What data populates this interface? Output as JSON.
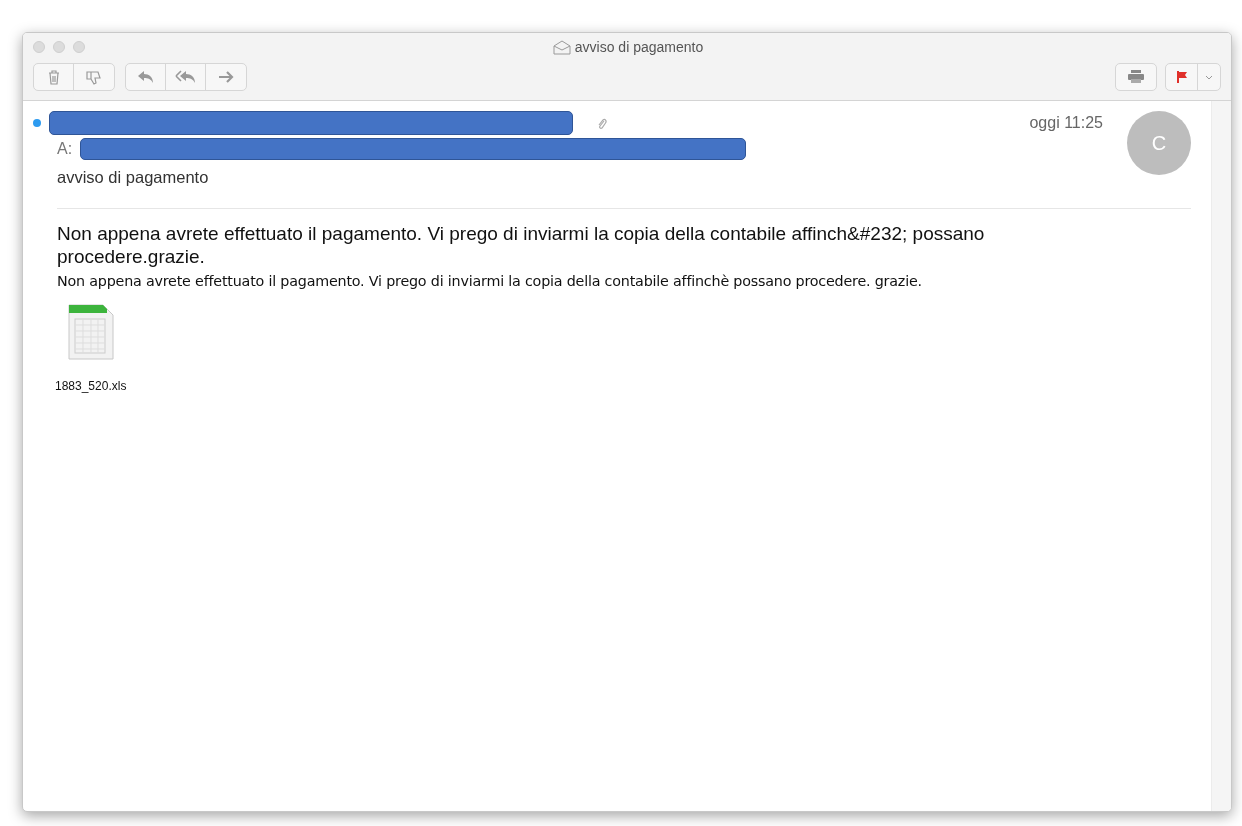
{
  "window": {
    "title": "avviso di pagamento"
  },
  "toolbar": {
    "flagged": true
  },
  "message": {
    "unread": true,
    "has_attachment": true,
    "to_label": "A:",
    "subject": "avviso di pagamento",
    "date": "oggi 11:25",
    "avatar_initial": "C",
    "body": [
      "Non appena avrete effettuato il pagamento. Vi prego di inviarmi la copia della contabile affinch&#232; possano procedere.grazie.",
      "Non appena avrete effettuato il pagamento. Vi prego di inviarmi la copia della contabile affinchè possano procedere. grazie."
    ],
    "attachments": [
      {
        "name": "1883_520.xls",
        "kind": "spreadsheet"
      }
    ]
  }
}
